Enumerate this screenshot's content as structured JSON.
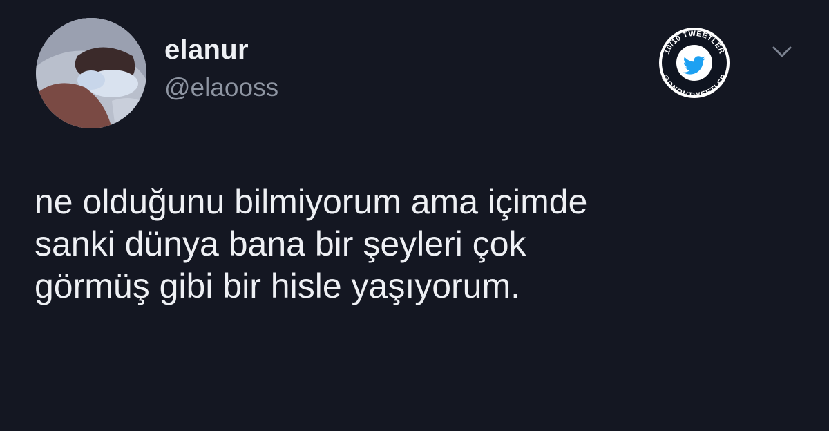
{
  "tweet": {
    "author": {
      "display_name": "elanur",
      "handle": "@elaooss"
    },
    "text_lines": [
      "ne olduğunu bilmiyorum ama içimde",
      "sanki dünya bana bir şeyleri çok",
      "görmüş gibi bir hisle yaşıyorum."
    ],
    "menu_icon": "chevron-down-icon"
  },
  "watermark": {
    "top_text": "10/10 TWEETLER",
    "bottom_text": "@ONONTWEETLER",
    "icon": "twitter-bird-icon"
  },
  "colors": {
    "background": "#141722",
    "primary_text": "#eef0f4",
    "secondary_text": "#8e95a2",
    "brand_blue": "#1da1f2"
  }
}
